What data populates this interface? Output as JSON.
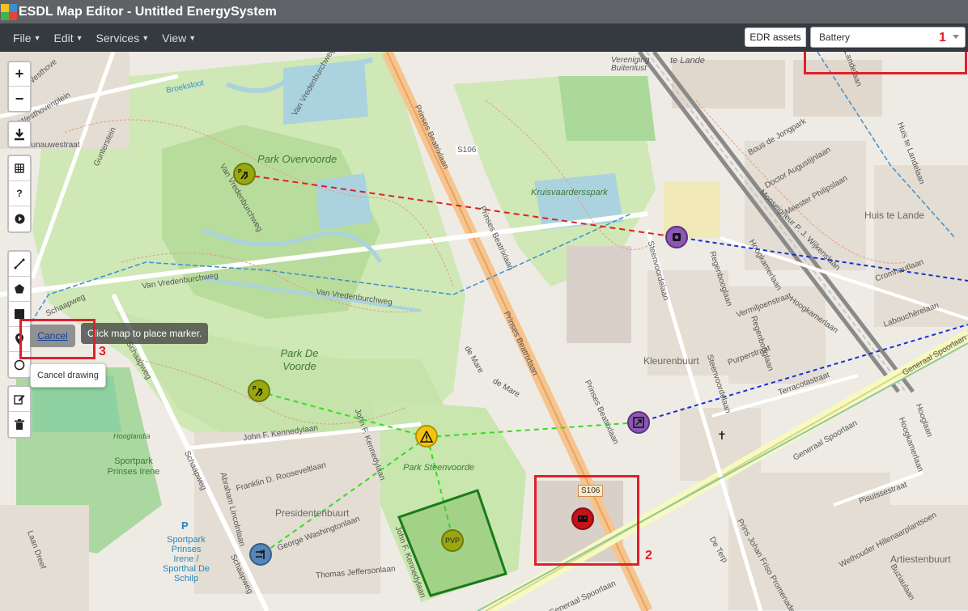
{
  "app": {
    "title": "ESDL Map Editor - Untitled EnergySystem"
  },
  "menu": {
    "items": [
      {
        "label": "File"
      },
      {
        "label": "Edit"
      },
      {
        "label": "Services"
      },
      {
        "label": "View"
      }
    ],
    "edr_button": "EDR assets",
    "asset_select": "Battery"
  },
  "map_controls": {
    "zoom_in": "+",
    "zoom_out": "−",
    "help": "?",
    "cancel_label": "Cancel",
    "tooltip_place": "Click map to place marker.",
    "tooltip_cancel": "Cancel drawing"
  },
  "annotations": [
    "1",
    "2",
    "3"
  ],
  "map_labels": {
    "streets": [
      "Westhovenplein",
      "Westhove",
      "Broeksloot",
      "Gunterstein",
      "Jaunauwestraat",
      "Van Vredenburchweg",
      "Van Vredenburchweg",
      "Van Vredenburchweg",
      "Van Vredenburchweg",
      "Prinses Beatrixlaan",
      "Prinses Beatrixlaan",
      "Prinses Beatrixlaan",
      "Prinses Beatrixlaan",
      "S106",
      "Schaapweg",
      "Schaapweg",
      "Schaapweg",
      "Schaapweg",
      "John F. Kennedylaan",
      "John F. Kennedylaan",
      "John F. Kennedylaan",
      "Franklin D. Rooseveltlaan",
      "George Washingtonlaan",
      "Thomas Jeffersonlaan",
      "Abraham Lincolnlaan",
      "Laan Dreef",
      "de Mare",
      "de Mare",
      "Steenvoordelaan",
      "Steenvoordelaan",
      "Regenbooglaan",
      "Regenbooglaan",
      "Vermiljoenstraat",
      "Purperstraat",
      "Terracotastraat",
      "Hoogkamerlaan",
      "Hoogkamerlaan",
      "Monseigneur P. J. Wijkenslaan",
      "Cromhoutlaan",
      "Labouchèrelaan",
      "Generaal Spoorlaan",
      "Generaal Spoorlaan",
      "Generaal Spoorlaan",
      "Pisuissestraat",
      "Wethouder Hillenaarplantsoen",
      "Prins Johan Friso Promenade",
      "De Terp",
      "Buziaulaan",
      "Bous de Jongpark",
      "Doctor Augustijnlaan",
      "Meester Philipslaan",
      "Huis te Landelaan",
      "Landelaan",
      "Hooglaan",
      "Vereniging Buitenlust",
      "te Lande",
      "Hoogkamerlaan"
    ],
    "parks": [
      "Park Overvoorde",
      "Kruisvaardersspark",
      "Park De Voorde",
      "Park Steenvoorde"
    ],
    "hoods": [
      "Huis te Lande",
      "Kleurenbuurt",
      "Presidentenbuurt",
      "Artiestenbuurt",
      "Sportpark Prinses Irene",
      "Hooglandia"
    ],
    "sport": "Sportpark Prinses Irene / Sporthal De Schilp",
    "parking": "P"
  },
  "markers": {
    "pvp": "PVP"
  },
  "colors": {
    "titlebar": "#5f6367",
    "menubar": "#343a40",
    "highlight": "#e0202a",
    "green_conn": "#33dd22",
    "red_conn": "#e02020",
    "blue_conn": "#1830d8",
    "park": "#c8e6b0",
    "marker_olive": "#9aa80f",
    "marker_purple": "#8c57b5",
    "marker_yellow": "#f2c40f",
    "marker_blue": "#5586b7",
    "marker_red": "#c4131b"
  }
}
